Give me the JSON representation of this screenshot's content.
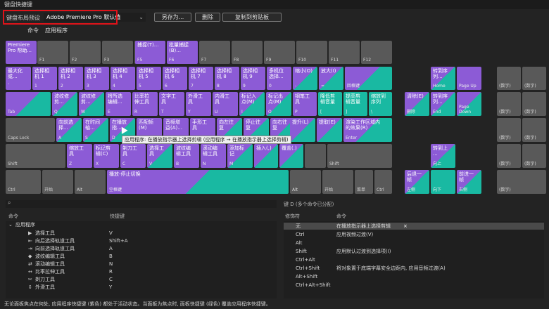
{
  "window": {
    "title": "键盘快捷键"
  },
  "toolbar": {
    "preset_label": "键盘布局预设",
    "preset_value": "Adobe Premiere Pro 默认值",
    "save_as": "另存为...",
    "delete": "删除",
    "copy_clipboard": "复制到剪贴板",
    "command_label": "命令",
    "command_value": "应用程序"
  },
  "keys": {
    "premiere_help": "Premiere\nPro 帮助...",
    "f1": "F1",
    "f2": "F2",
    "f3": "F3",
    "f4": "F4",
    "f5_top": "捕捉(T)...",
    "f5": "F5",
    "f6_top": "批量捕捉\n(B)...",
    "f6": "F6",
    "f7": "F7",
    "f8": "F8",
    "f9": "F9",
    "f10": "F10",
    "f11": "F11",
    "f12": "F12",
    "max_top": "最大化\n或...",
    "backquote": "`",
    "n1_top": "选择相\n机 1",
    "n1": "1",
    "n2_top": "选择相\n机 2",
    "n2": "2",
    "n3_top": "选择相\n机 3",
    "n3": "3",
    "n4_top": "选择相\n机 4",
    "n4": "4",
    "n5_top": "选择相\n机 5",
    "n5": "5",
    "n6_top": "选择相\n机 6",
    "n6": "6",
    "n7_top": "选择相\n机 7",
    "n7": "7",
    "n8_top": "选择相\n机 8",
    "n8": "8",
    "n9_top": "选择相\n机 9",
    "n9": "9",
    "n0_top": "多机位\n选择...",
    "n0": "0",
    "minus_top": "缩小(O)",
    "minus": "-",
    "equal_top": "放大(I)",
    "equal": "=",
    "backspace": "回格键",
    "home_top": "转到序\n列...",
    "home": "Home",
    "pgup": "Page Up",
    "tab": "Tab",
    "q_top": "波纹修\n剪...",
    "q": "Q",
    "w_top": "波纹修\n剪...",
    "w": "W",
    "e_top": "将所选\n编辑...",
    "e": "E",
    "r_top": "比率拉\n伸工具",
    "r": "R",
    "t_top": "文字工\n具",
    "t": "T",
    "y_top": "外滑工\n具",
    "y": "Y",
    "u_top": "内滑工\n具",
    "u": "U",
    "i_top": "标记入\n点(M)",
    "i": "I",
    "o_top": "标记出\n点(M)",
    "o": "O",
    "p_top": "钢笔工\n具",
    "p": "P",
    "lbr_top": "降低剪\n辑音量",
    "lbr": "[",
    "rbr_top": "提高剪\n辑音量",
    "rbr": "]",
    "bsl_top": "缩放到\n序列",
    "bsl": "\\",
    "del_top": "清除(E)",
    "del": "删除",
    "end_top": "转到序\n列...",
    "end": "End",
    "pgdn": "Page\nDown",
    "caps": "Caps Lock",
    "a_top": "向前选\n择...",
    "a": "A",
    "s_top": "在时间\n轴...",
    "s": "S",
    "d_top": "在播放\n指...",
    "d": "D",
    "f_top": "匹配帧\n(M)",
    "f": "F",
    "g_top": "音频增\n益(A)...",
    "g": "G",
    "h_top": "手形工\n具",
    "h": "H",
    "j_top": "向左往\n复",
    "j": "J",
    "k_top": "停止往\n复",
    "k": "K",
    "l_top": "向右往\n复",
    "l": "L",
    "semi_top": "提升(L)",
    "quote_top": "提取(E)",
    "enter_top": "渲染工作区域内\n的效果(R)",
    "enter": "Enter",
    "shift_l": "Shift",
    "z_top": "缩放工\n具",
    "z": "Z",
    "x_top": "标记剪\n辑(C)",
    "x": "X",
    "c_top": "剃刀工\n具",
    "c": "C",
    "v_top": "选择工\n具",
    "v": "V",
    "b_top": "波纹编\n辑工具",
    "b": "B",
    "n_top": "滚动编\n辑工具",
    "n": "N",
    "m_top": "添加标\n记",
    "m": "M",
    "comma_top": "插入(,)",
    "period_top": "覆盖(.)",
    "shift_r": "Shift",
    "up_top": "转到上\n...",
    "up": "向上",
    "ctrl_l": "Ctrl",
    "start": "开始",
    "alt_l": "Alt",
    "space_top": "播放-停止切换",
    "space": "空格键",
    "alt_r": "Alt",
    "start_r": "开始",
    "menu": "菜单",
    "ctrl_r": "Ctrl",
    "left_top": "后退一\n帧",
    "left": "左侧",
    "down": "向下",
    "right_top": "前进一\n帧",
    "right": "右侧",
    "np": "(数字)"
  },
  "tooltip": "应用程序: 在播放指示器上选择剪辑 (应用程序 → 在播放指示器上选择剪辑)",
  "lower": {
    "search_icon": "search-icon",
    "key_info": "键 D (多个命令已分配)",
    "col_command": "命令",
    "col_shortcut": "快捷键",
    "col_modifier": "修饰符",
    "col_command2": "命令",
    "tree_group": "应用程序",
    "tree_rows": [
      {
        "label": "选择工具",
        "shortcut": "V",
        "icon": "▶"
      },
      {
        "label": "向后选择轨道工具",
        "shortcut": "Shift+A",
        "icon": "⇤"
      },
      {
        "label": "向前选择轨道工具",
        "shortcut": "A",
        "icon": "⇥"
      },
      {
        "label": "波纹编辑工具",
        "shortcut": "B",
        "icon": "◆"
      },
      {
        "label": "滚动编辑工具",
        "shortcut": "N",
        "icon": "⇄"
      },
      {
        "label": "比率拉伸工具",
        "shortcut": "R",
        "icon": "↔"
      },
      {
        "label": "剃刀工具",
        "shortcut": "C",
        "icon": "✂"
      },
      {
        "label": "外滑工具",
        "shortcut": "Y",
        "icon": "↕"
      }
    ],
    "mods": [
      {
        "mod": "无",
        "cmd": "在播放指示器上选择剪辑"
      },
      {
        "mod": "Ctrl",
        "cmd": "应用视频过渡(V)"
      },
      {
        "mod": "Alt",
        "cmd": ""
      },
      {
        "mod": "Shift",
        "cmd": "应用默认过渡到选择项(I)"
      },
      {
        "mod": "Ctrl+Alt",
        "cmd": ""
      },
      {
        "mod": "Ctrl+Shift",
        "cmd": "将对象置于底端字幕安全边距内, 应用音频过渡(A)"
      },
      {
        "mod": "Alt+Shift",
        "cmd": ""
      },
      {
        "mod": "Ctrl+Alt+Shift",
        "cmd": ""
      }
    ],
    "remove_x": "×"
  },
  "status": "无论面板焦点在何处, 应用程序快捷键 (紫色) 都处于活动状态。当面板为焦点时, 面板快捷键 (绿色) 覆盖应用程序快捷键。"
}
